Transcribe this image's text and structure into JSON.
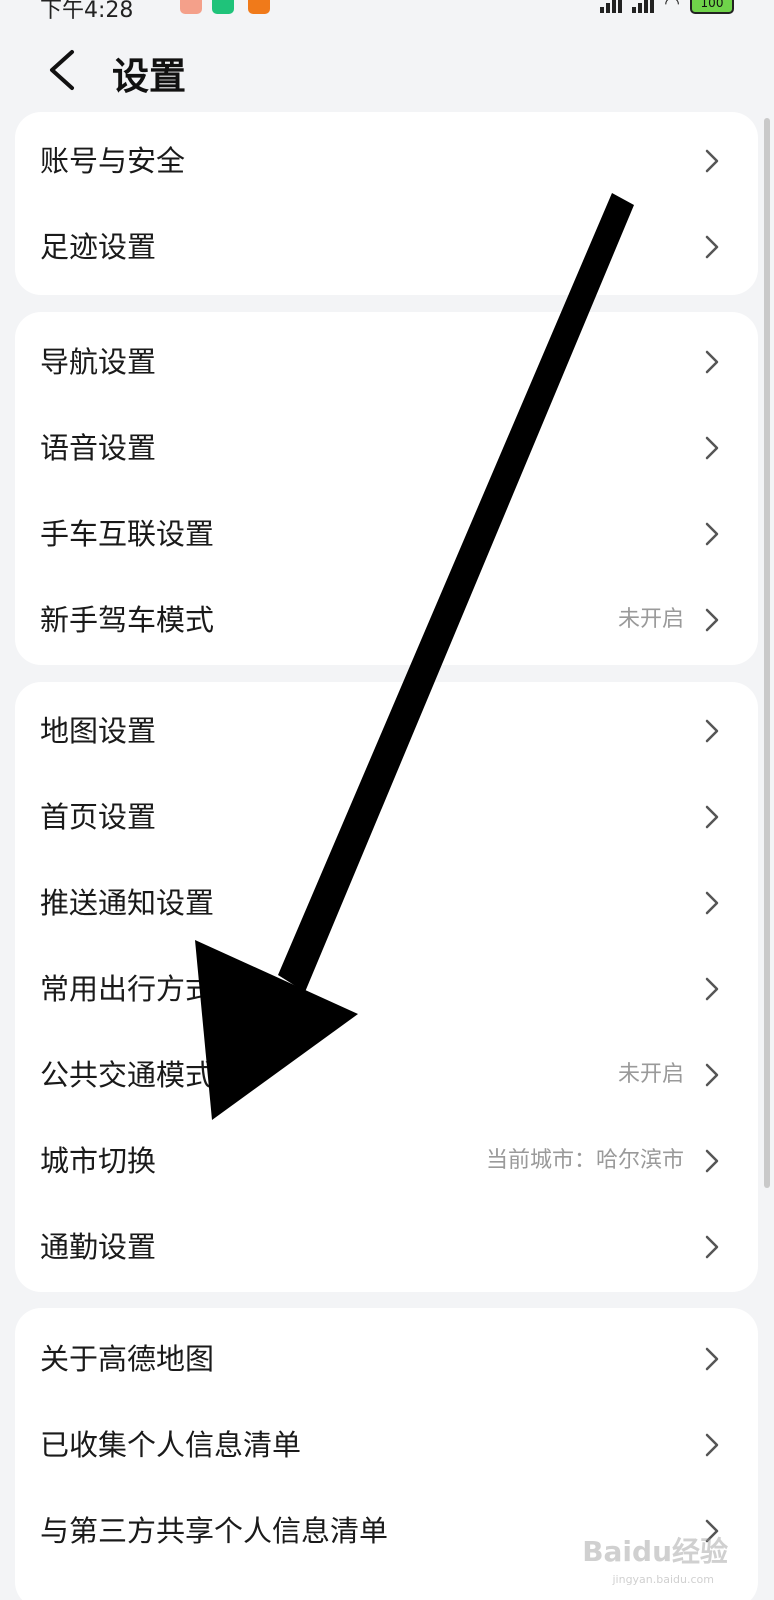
{
  "status_bar": {
    "time": "下午4:28",
    "battery": "100"
  },
  "header": {
    "title": "设置"
  },
  "groups": [
    {
      "items": [
        {
          "label": "账号与安全",
          "value": ""
        },
        {
          "label": "足迹设置",
          "value": ""
        }
      ]
    },
    {
      "items": [
        {
          "label": "导航设置",
          "value": ""
        },
        {
          "label": "语音设置",
          "value": ""
        },
        {
          "label": "手车互联设置",
          "value": ""
        },
        {
          "label": "新手驾车模式",
          "value": "未开启"
        }
      ]
    },
    {
      "items": [
        {
          "label": "地图设置",
          "value": ""
        },
        {
          "label": "首页设置",
          "value": ""
        },
        {
          "label": "推送通知设置",
          "value": ""
        },
        {
          "label": "常用出行方式",
          "value": ""
        },
        {
          "label": "公共交通模式",
          "value": "未开启"
        },
        {
          "label": "城市切换",
          "value": "当前城市：哈尔滨市"
        },
        {
          "label": "通勤设置",
          "value": ""
        }
      ]
    },
    {
      "items": [
        {
          "label": "关于高德地图",
          "value": ""
        },
        {
          "label": "已收集个人信息清单",
          "value": ""
        },
        {
          "label": "与第三方共享个人信息清单",
          "value": ""
        }
      ]
    }
  ],
  "watermark": {
    "text": "Baidu经验",
    "sub": "jingyan.baidu.com"
  },
  "colors": {
    "background": "#f3f4f6",
    "card": "#ffffff",
    "text": "#1a1a1a",
    "secondary_text": "#9a9a9a",
    "arrow": "#000000"
  }
}
